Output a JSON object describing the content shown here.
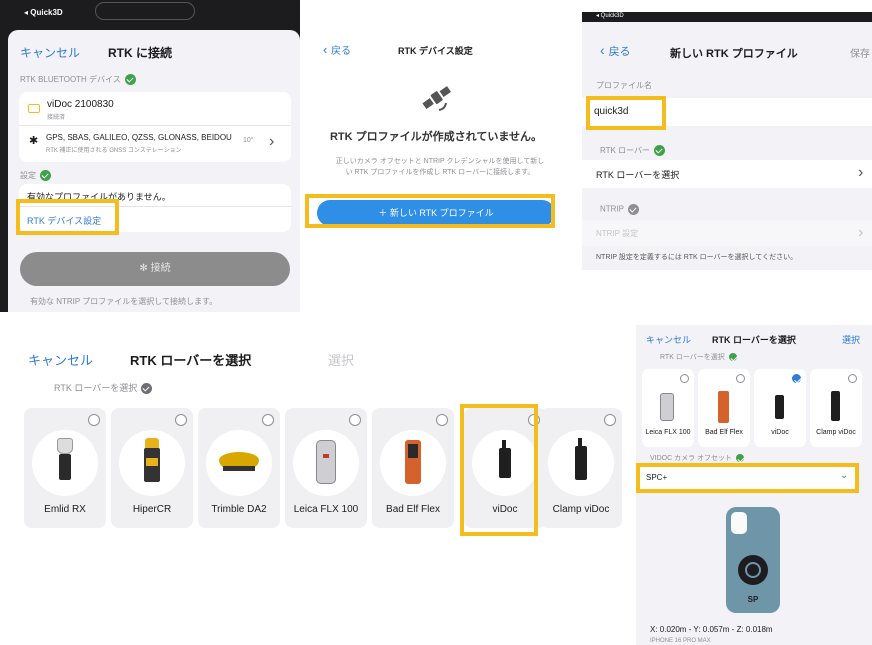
{
  "panel1": {
    "status_app": "◂ Quick3D",
    "cancel": "キャンセル",
    "title": "RTK に接続",
    "bt_section": "RTK BLUETOOTH デバイス",
    "device_name": "viDoc 2100830",
    "device_status": "接続済",
    "gnss_text": "GPS, SBAS, GALILEO, QZSS, GLONASS, BEIDOU",
    "gnss_sub": "RTK 補正に使用される GNSS コンステレーション",
    "gnss_value": "10°",
    "settings_section": "設定",
    "no_profile": "有効なプロファイルがありません。",
    "device_settings_link": "RTK デバイス設定",
    "connect_button": "接続",
    "footer": "有効な NTRIP プロファイルを選択して接続します。"
  },
  "panel2": {
    "back": "戻る",
    "title": "RTK デバイス設定",
    "empty_title": "RTK プロファイルが作成されていません。",
    "empty_desc": "正しいカメラ オフセットと NTRIP クレデンシャルを使用して新しい RTK プロファイルを作成し RTK ローバーに接続します。",
    "new_profile_button": "＋ 新しい RTK プロファイル"
  },
  "panel3": {
    "status_app": "◂ Quick3D",
    "back": "戻る",
    "title": "新しい RTK プロファイル",
    "save": "保存",
    "profile_name_label": "プロファイル名",
    "profile_name_value": "quick3d",
    "rover_section": "RTK ローバー",
    "rover_select": "RTK ローバーを選択",
    "ntrip_section": "NTRIP",
    "ntrip_settings": "NTRIP 設定",
    "ntrip_note": "NTRIP 設定を定義するには RTK ローバーを選択してください。"
  },
  "panel4": {
    "cancel": "キャンセル",
    "title": "RTK ローバーを選択",
    "select": "選択",
    "section": "RTK ローバーを選択",
    "rovers": [
      {
        "label": "Emlid RX"
      },
      {
        "label": "HiperCR"
      },
      {
        "label": "Trimble DA2"
      },
      {
        "label": "Leica FLX 100"
      },
      {
        "label": "Bad Elf Flex"
      },
      {
        "label": "viDoc"
      },
      {
        "label": "Clamp viDoc"
      }
    ]
  },
  "panel5": {
    "cancel": "キャンセル",
    "title": "RTK ローバーを選択",
    "select": "選択",
    "section": "RTK ローバーを選択",
    "rovers": [
      {
        "label": "Leica FLX 100",
        "selected": false
      },
      {
        "label": "Bad Elf Flex",
        "selected": false
      },
      {
        "label": "viDoc",
        "selected": true
      },
      {
        "label": "Clamp viDoc",
        "selected": false
      }
    ],
    "offset_section": "VIDOC カメラ オフセット",
    "offset_value": "SPC+",
    "case_brand": "SP",
    "offset_readout": "X: 0.020m - Y: 0.057m - Z: 0.018m",
    "device_model": "IPHONE 16 PRO MAX"
  },
  "colors": {
    "accent": "#2f7bd8",
    "highlight": "#f4bc1c",
    "check": "#3fa14a",
    "connect_disabled": "#8c8c8c"
  }
}
